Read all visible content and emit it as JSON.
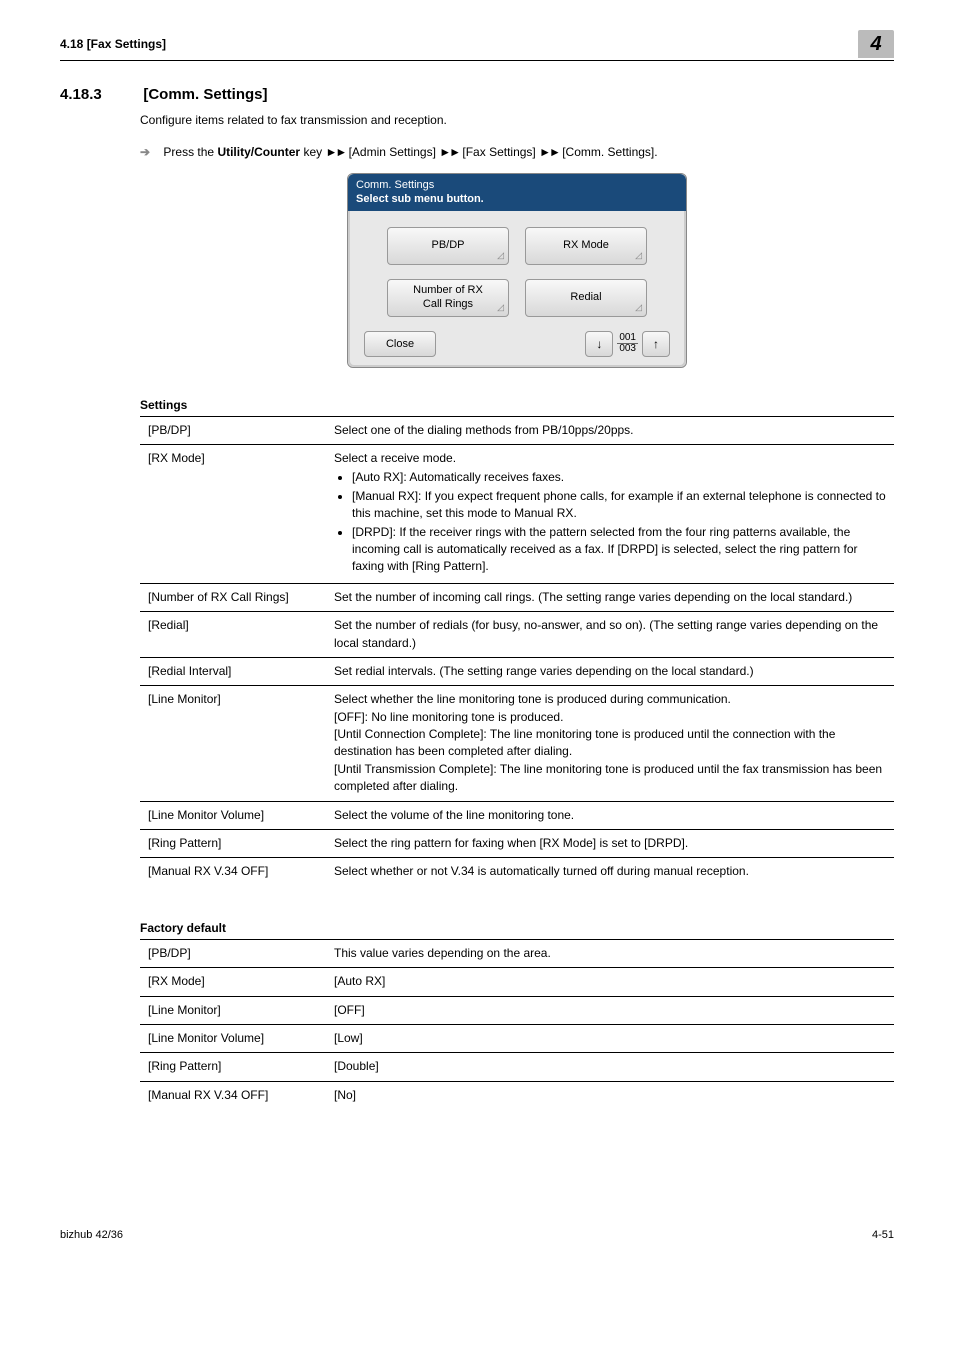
{
  "header": {
    "left": "4.18    [Fax Settings]",
    "chapter": "4"
  },
  "section": {
    "number": "4.18.3",
    "title": "[Comm. Settings]"
  },
  "intro": "Configure items related to fax transmission and reception.",
  "path_prefix": "Press the ",
  "path_key": "Utility/Counter",
  "path_suffix": " key ",
  "arrow": "►►",
  "path_items": [
    "[Admin Settings]",
    "[Fax Settings]",
    "[Comm. Settings]."
  ],
  "screenshot": {
    "title_line1": "Comm. Settings",
    "title_line2": "Select sub menu button.",
    "buttons": [
      "PB/DP",
      "RX Mode",
      "Number of RX\nCall Rings",
      "Redial"
    ],
    "close": "Close",
    "page_top": "001",
    "page_bot": "003"
  },
  "tables": {
    "settings_title": "Settings",
    "settings": [
      {
        "k": "[PB/DP]",
        "v": "Select one of the dialing methods from PB/10pps/20pps."
      },
      {
        "k": "[RX Mode]",
        "v_pre": "Select a receive mode.",
        "v_list": [
          "[Auto RX]: Automatically receives faxes.",
          "[Manual RX]: If you expect frequent phone calls, for example if an external telephone is connected to this machine, set this mode to Manual RX.",
          "[DRPD]: If the receiver rings with the pattern selected from the four ring patterns available, the incoming call is automatically received as a fax. If [DRPD] is selected, select the ring pattern for faxing with [Ring Pattern]."
        ]
      },
      {
        "k": "[Number of RX Call Rings]",
        "v": "Set the number of incoming call rings. (The setting range varies depending on the local standard.)"
      },
      {
        "k": "[Redial]",
        "v": "Set the number of redials (for busy, no-answer, and so on). (The setting range varies depending on the local standard.)"
      },
      {
        "k": "[Redial Interval]",
        "v": "Set redial intervals. (The setting range varies depending on the local standard.)"
      },
      {
        "k": "[Line Monitor]",
        "v": "Select whether the line monitoring tone is produced during communication.\n[OFF]: No line monitoring tone is produced.\n[Until Connection Complete]: The line monitoring tone is produced until the connection with the destination has been completed after dialing.\n[Until Transmission Complete]: The line monitoring tone is produced until the fax transmission has been completed after dialing."
      },
      {
        "k": "[Line Monitor Volume]",
        "v": "Select the volume of the line monitoring tone."
      },
      {
        "k": "[Ring Pattern]",
        "v": "Select the ring pattern for faxing when [RX Mode] is set to [DRPD]."
      },
      {
        "k": "[Manual RX V.34 OFF]",
        "v": "Select whether or not V.34 is automatically turned off during manual reception."
      }
    ],
    "defaults_title": "Factory default",
    "defaults": [
      {
        "k": "[PB/DP]",
        "v": "This value varies depending on the area."
      },
      {
        "k": "[RX Mode]",
        "v": "[Auto RX]"
      },
      {
        "k": "[Line Monitor]",
        "v": "[OFF]"
      },
      {
        "k": "[Line Monitor Volume]",
        "v": "[Low]"
      },
      {
        "k": "[Ring Pattern]",
        "v": "[Double]"
      },
      {
        "k": "[Manual RX V.34 OFF]",
        "v": "[No]"
      }
    ]
  },
  "footer": {
    "left": "bizhub 42/36",
    "right": "4-51"
  }
}
